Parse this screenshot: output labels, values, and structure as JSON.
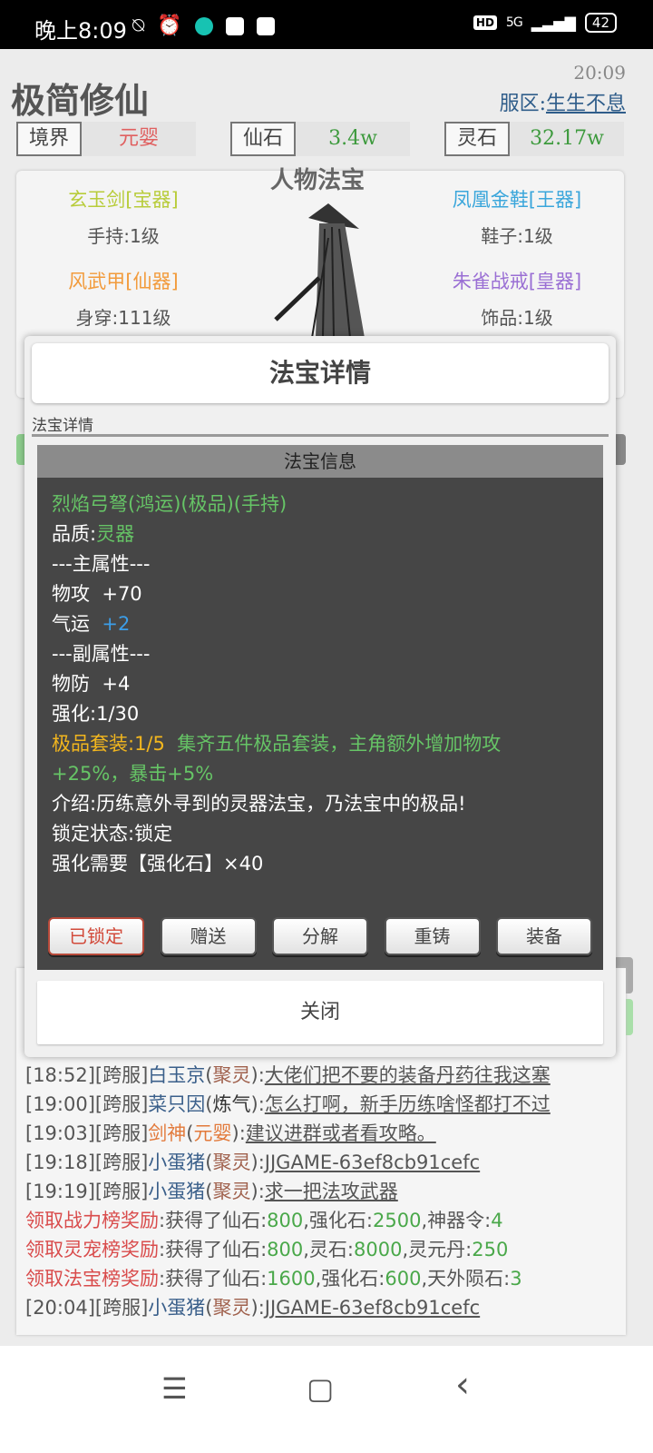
{
  "status_bar": {
    "time": "晚上8:09",
    "network": "5G",
    "hd": "HD",
    "battery": "42"
  },
  "header": {
    "app_title": "极简修仙",
    "clock": "20:09",
    "server_label": "服区:",
    "server_name": "生生不息"
  },
  "stats": [
    {
      "label": "境界",
      "value": "元婴"
    },
    {
      "label": "仙石",
      "value": "3.4w"
    },
    {
      "label": "灵石",
      "value": "32.17w"
    }
  ],
  "equipment": {
    "title": "人物法宝",
    "weapon": {
      "name": "玄玉剑[宝器]",
      "slot": "手持:1级"
    },
    "shoes": {
      "name": "凤凰金鞋[王器]",
      "slot": "鞋子:1级"
    },
    "armor": {
      "name": "风武甲[仙器]",
      "slot": "身穿:111级"
    },
    "ring": {
      "name": "朱雀战戒[皇器]",
      "slot": "饰品:1级"
    }
  },
  "modal": {
    "title": "法宝详情",
    "subtitle": "法宝详情",
    "info_title": "法宝信息",
    "item_name": "烈焰弓弩(鸿运)(极品)(手持)",
    "quality_label": "品质:",
    "quality_value": "灵器",
    "main_attr_header": "---主属性---",
    "phys_atk": "物攻  +70",
    "luck_label": "气运  ",
    "luck_value": "+2",
    "sub_attr_header": "---副属性---",
    "phys_def": "物防  +4",
    "enhance": "强化:1/30",
    "set_label": "极品套装:1/5",
    "set_desc_1": "  集齐五件极品套装，主角额外增加物攻",
    "set_desc_2": "+25%，暴击+5%",
    "intro": "介绍:历练意外寻到的灵器法宝，乃法宝中的极品!",
    "lock_status": "锁定状态:锁定",
    "enhance_need": "强化需要【强化石】×40",
    "buttons": [
      "已锁定",
      "赠送",
      "分解",
      "重铸",
      "装备"
    ],
    "close": "关闭"
  },
  "chat": [
    {
      "time": "[18:52]",
      "tag": "[跨服]",
      "name": "白玉京",
      "realm": "聚灵",
      "msg": "大佬们把不要的装备丹药往我这塞"
    },
    {
      "time": "[19:00]",
      "tag": "[跨服]",
      "name": "菜只因",
      "realm": "炼气",
      "msg": "怎么打啊，新手历练啥怪都打不过"
    },
    {
      "time": "[19:03]",
      "tag": "[跨服]",
      "name": "剑神",
      "realm": "元婴",
      "msg": "建议进群或者看攻略。"
    },
    {
      "time": "[19:18]",
      "tag": "[跨服]",
      "name": "小蛋猪",
      "realm": "聚灵",
      "msg": "JJGAME-63ef8cb91cefc"
    },
    {
      "time": "[19:19]",
      "tag": "[跨服]",
      "name": "小蛋猪",
      "realm": "聚灵",
      "msg": "求一把法攻武器"
    },
    {
      "label": "领取战力榜奖励",
      "text": ":获得了仙石:",
      "v1": "800",
      "k2": ",强化石:",
      "v2": "2500",
      "k3": ",神器令:",
      "v3": "4"
    },
    {
      "label": "领取灵宠榜奖励",
      "text": ":获得了仙石:",
      "v1": "800",
      "k2": ",灵石:",
      "v2": "8000",
      "k3": ",灵元丹:",
      "v3": "250"
    },
    {
      "label": "领取法宝榜奖励",
      "text": ":获得了仙石:",
      "v1": "1600",
      "k2": ",强化石:",
      "v2": "600",
      "k3": ",天外陨石:",
      "v3": "3"
    },
    {
      "time": "[20:04]",
      "tag": "[跨服]",
      "name": "小蛋猪",
      "realm": "聚灵",
      "msg": "JJGAME-63ef8cb91cefc"
    }
  ],
  "nav": {
    "menu_icon": "☰",
    "home_icon": "▢",
    "back_icon": "‹"
  }
}
